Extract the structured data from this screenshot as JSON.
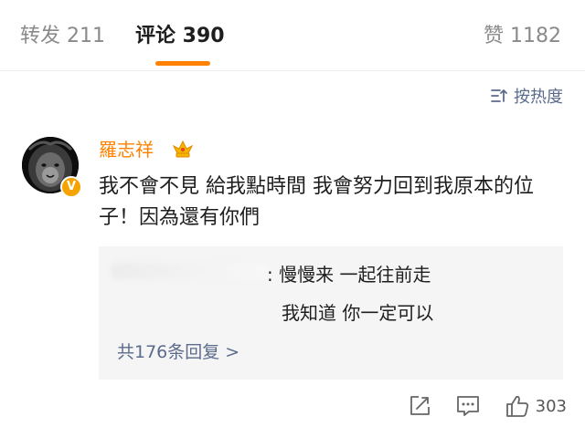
{
  "tabs": {
    "repost": "转发 211",
    "comments": "评论 390",
    "likes": "赞 1182"
  },
  "sort_label": "按热度",
  "comment": {
    "username": "羅志祥",
    "text": "我不會不見 給我點時間 我會努力回到我原本的位子！因為還有你們",
    "like_count": "303"
  },
  "replies": {
    "line1": ": 慢慢来 一起往前走",
    "line2": "我知道 你一定可以",
    "more": "共176条回复 >"
  },
  "colors": {
    "accent": "#ff8200",
    "link": "#5b6b8c"
  },
  "icons": [
    "sort-icon",
    "crown-icon",
    "verified-icon",
    "share-icon",
    "comment-icon",
    "like-icon"
  ]
}
